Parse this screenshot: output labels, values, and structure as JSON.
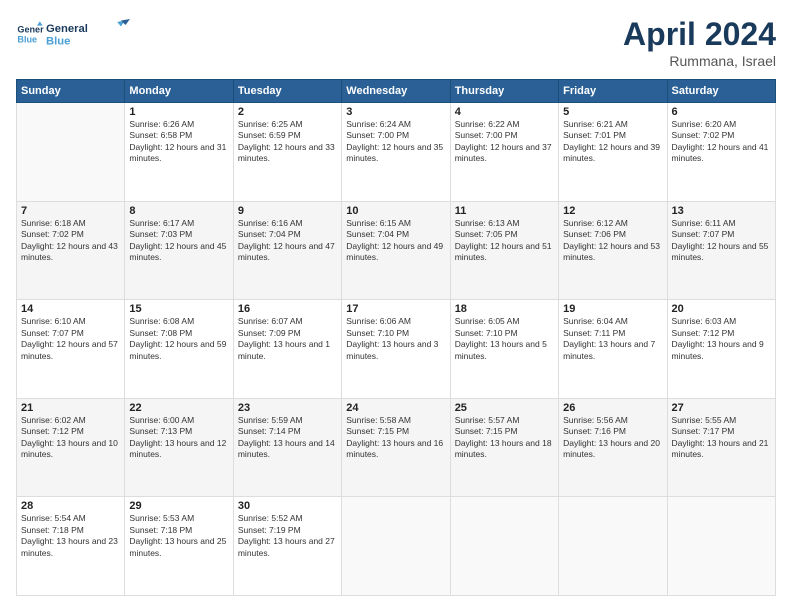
{
  "header": {
    "logo_line1": "General",
    "logo_line2": "Blue",
    "month_title": "April 2024",
    "subtitle": "Rummana, Israel"
  },
  "weekdays": [
    "Sunday",
    "Monday",
    "Tuesday",
    "Wednesday",
    "Thursday",
    "Friday",
    "Saturday"
  ],
  "weeks": [
    [
      {
        "day": null,
        "info": null
      },
      {
        "day": "1",
        "sunrise": "6:26 AM",
        "sunset": "6:58 PM",
        "daylight": "12 hours and 31 minutes."
      },
      {
        "day": "2",
        "sunrise": "6:25 AM",
        "sunset": "6:59 PM",
        "daylight": "12 hours and 33 minutes."
      },
      {
        "day": "3",
        "sunrise": "6:24 AM",
        "sunset": "7:00 PM",
        "daylight": "12 hours and 35 minutes."
      },
      {
        "day": "4",
        "sunrise": "6:22 AM",
        "sunset": "7:00 PM",
        "daylight": "12 hours and 37 minutes."
      },
      {
        "day": "5",
        "sunrise": "6:21 AM",
        "sunset": "7:01 PM",
        "daylight": "12 hours and 39 minutes."
      },
      {
        "day": "6",
        "sunrise": "6:20 AM",
        "sunset": "7:02 PM",
        "daylight": "12 hours and 41 minutes."
      }
    ],
    [
      {
        "day": "7",
        "sunrise": "6:18 AM",
        "sunset": "7:02 PM",
        "daylight": "12 hours and 43 minutes."
      },
      {
        "day": "8",
        "sunrise": "6:17 AM",
        "sunset": "7:03 PM",
        "daylight": "12 hours and 45 minutes."
      },
      {
        "day": "9",
        "sunrise": "6:16 AM",
        "sunset": "7:04 PM",
        "daylight": "12 hours and 47 minutes."
      },
      {
        "day": "10",
        "sunrise": "6:15 AM",
        "sunset": "7:04 PM",
        "daylight": "12 hours and 49 minutes."
      },
      {
        "day": "11",
        "sunrise": "6:13 AM",
        "sunset": "7:05 PM",
        "daylight": "12 hours and 51 minutes."
      },
      {
        "day": "12",
        "sunrise": "6:12 AM",
        "sunset": "7:06 PM",
        "daylight": "12 hours and 53 minutes."
      },
      {
        "day": "13",
        "sunrise": "6:11 AM",
        "sunset": "7:07 PM",
        "daylight": "12 hours and 55 minutes."
      }
    ],
    [
      {
        "day": "14",
        "sunrise": "6:10 AM",
        "sunset": "7:07 PM",
        "daylight": "12 hours and 57 minutes."
      },
      {
        "day": "15",
        "sunrise": "6:08 AM",
        "sunset": "7:08 PM",
        "daylight": "12 hours and 59 minutes."
      },
      {
        "day": "16",
        "sunrise": "6:07 AM",
        "sunset": "7:09 PM",
        "daylight": "13 hours and 1 minute."
      },
      {
        "day": "17",
        "sunrise": "6:06 AM",
        "sunset": "7:10 PM",
        "daylight": "13 hours and 3 minutes."
      },
      {
        "day": "18",
        "sunrise": "6:05 AM",
        "sunset": "7:10 PM",
        "daylight": "13 hours and 5 minutes."
      },
      {
        "day": "19",
        "sunrise": "6:04 AM",
        "sunset": "7:11 PM",
        "daylight": "13 hours and 7 minutes."
      },
      {
        "day": "20",
        "sunrise": "6:03 AM",
        "sunset": "7:12 PM",
        "daylight": "13 hours and 9 minutes."
      }
    ],
    [
      {
        "day": "21",
        "sunrise": "6:02 AM",
        "sunset": "7:12 PM",
        "daylight": "13 hours and 10 minutes."
      },
      {
        "day": "22",
        "sunrise": "6:00 AM",
        "sunset": "7:13 PM",
        "daylight": "13 hours and 12 minutes."
      },
      {
        "day": "23",
        "sunrise": "5:59 AM",
        "sunset": "7:14 PM",
        "daylight": "13 hours and 14 minutes."
      },
      {
        "day": "24",
        "sunrise": "5:58 AM",
        "sunset": "7:15 PM",
        "daylight": "13 hours and 16 minutes."
      },
      {
        "day": "25",
        "sunrise": "5:57 AM",
        "sunset": "7:15 PM",
        "daylight": "13 hours and 18 minutes."
      },
      {
        "day": "26",
        "sunrise": "5:56 AM",
        "sunset": "7:16 PM",
        "daylight": "13 hours and 20 minutes."
      },
      {
        "day": "27",
        "sunrise": "5:55 AM",
        "sunset": "7:17 PM",
        "daylight": "13 hours and 21 minutes."
      }
    ],
    [
      {
        "day": "28",
        "sunrise": "5:54 AM",
        "sunset": "7:18 PM",
        "daylight": "13 hours and 23 minutes."
      },
      {
        "day": "29",
        "sunrise": "5:53 AM",
        "sunset": "7:18 PM",
        "daylight": "13 hours and 25 minutes."
      },
      {
        "day": "30",
        "sunrise": "5:52 AM",
        "sunset": "7:19 PM",
        "daylight": "13 hours and 27 minutes."
      },
      {
        "day": null,
        "info": null
      },
      {
        "day": null,
        "info": null
      },
      {
        "day": null,
        "info": null
      },
      {
        "day": null,
        "info": null
      }
    ]
  ]
}
